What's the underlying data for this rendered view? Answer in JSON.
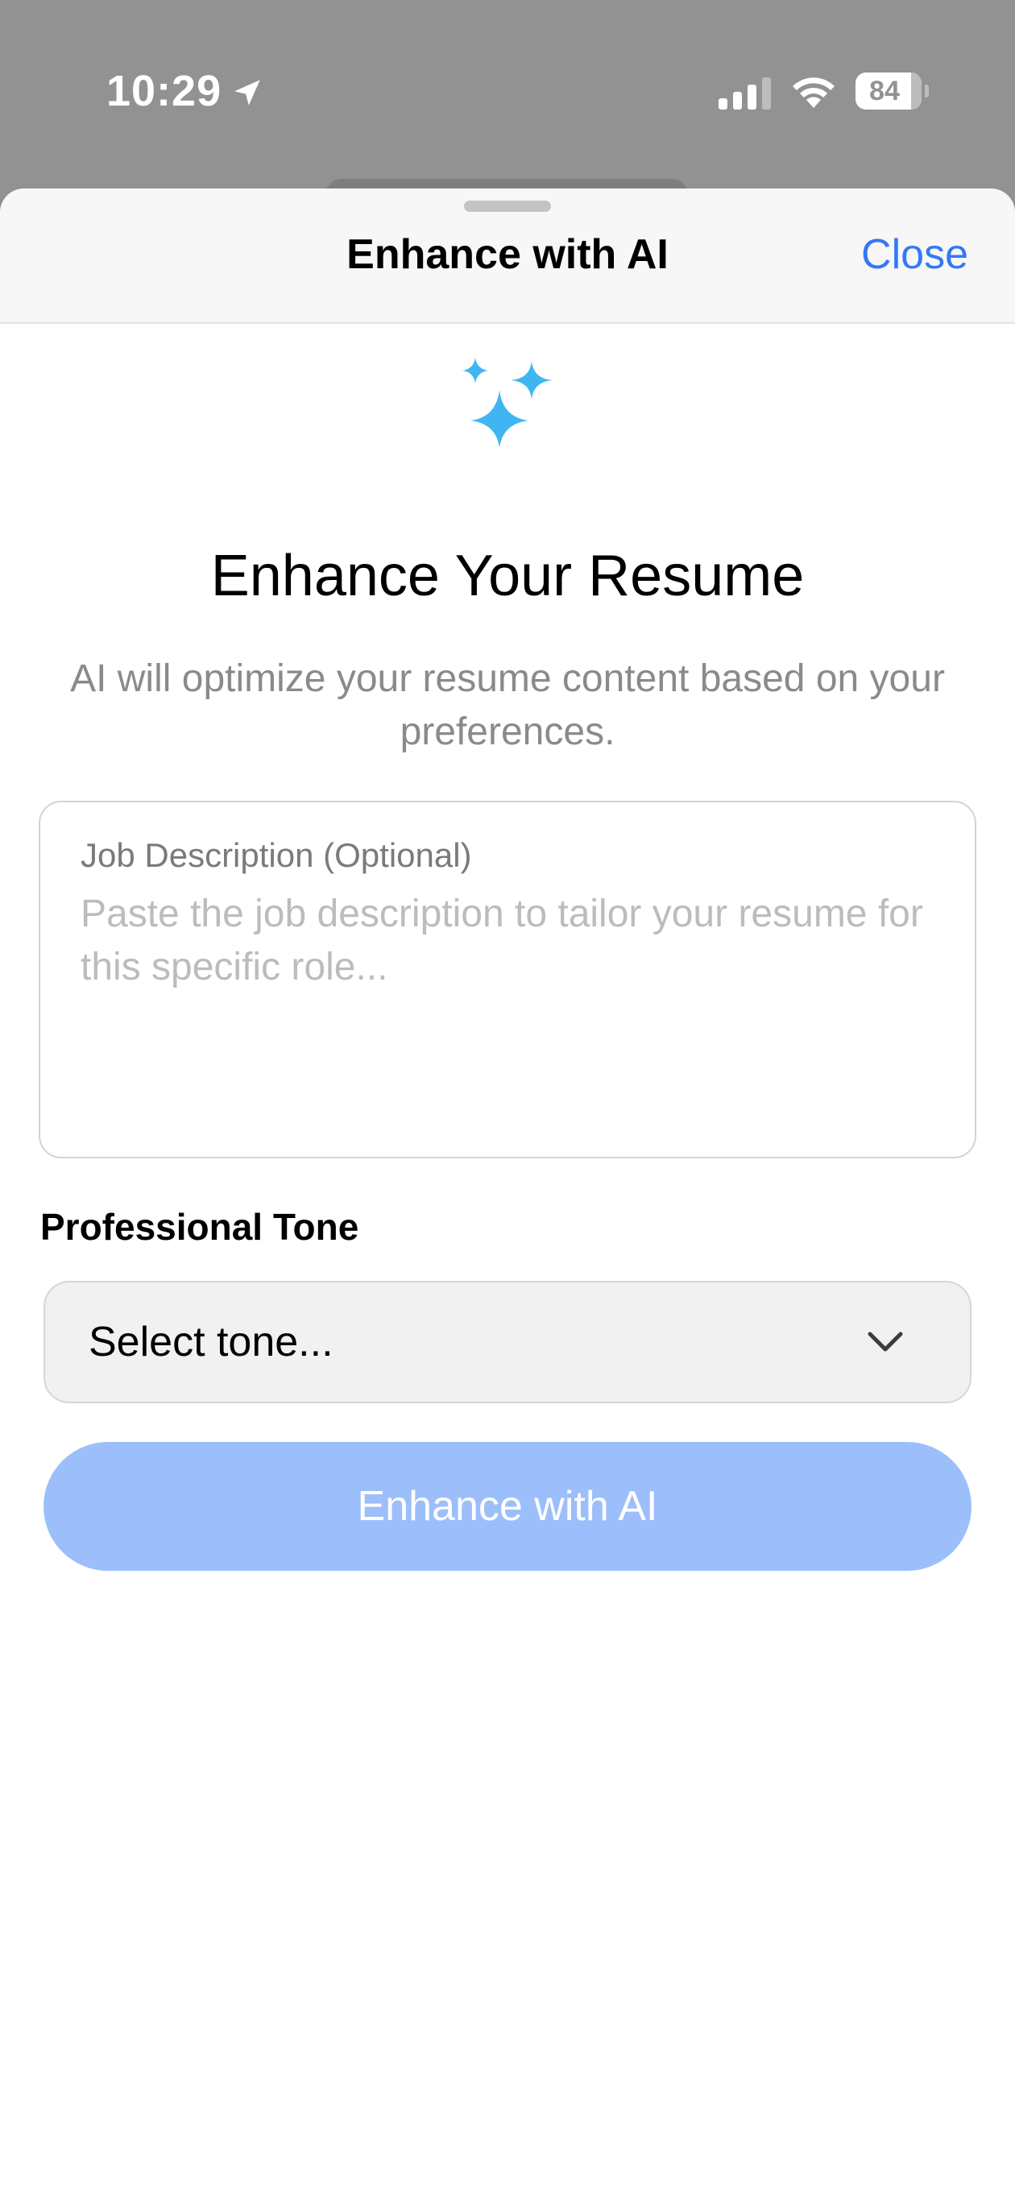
{
  "status_bar": {
    "time": "10:29",
    "battery": "84"
  },
  "sheet": {
    "title": "Enhance with AI",
    "close_label": "Close"
  },
  "content": {
    "headline": "Enhance Your Resume",
    "subtitle": "AI will optimize your resume content based on your preferences.",
    "job_description": {
      "label": "Job Description (Optional)",
      "placeholder": "Paste the job description to tailor your resume for this specific role...",
      "value": ""
    },
    "tone": {
      "label": "Professional Tone",
      "selected": "Select tone..."
    },
    "enhance_button_label": "Enhance with AI"
  },
  "colors": {
    "accent": "#3478f6",
    "sparkle": "#3fb6f2",
    "button_disabled": "#9cbffb"
  },
  "icons": [
    "location-arrow-icon",
    "signal-icon",
    "wifi-icon",
    "battery-icon",
    "sparkles-icon",
    "chevron-down-icon"
  ]
}
